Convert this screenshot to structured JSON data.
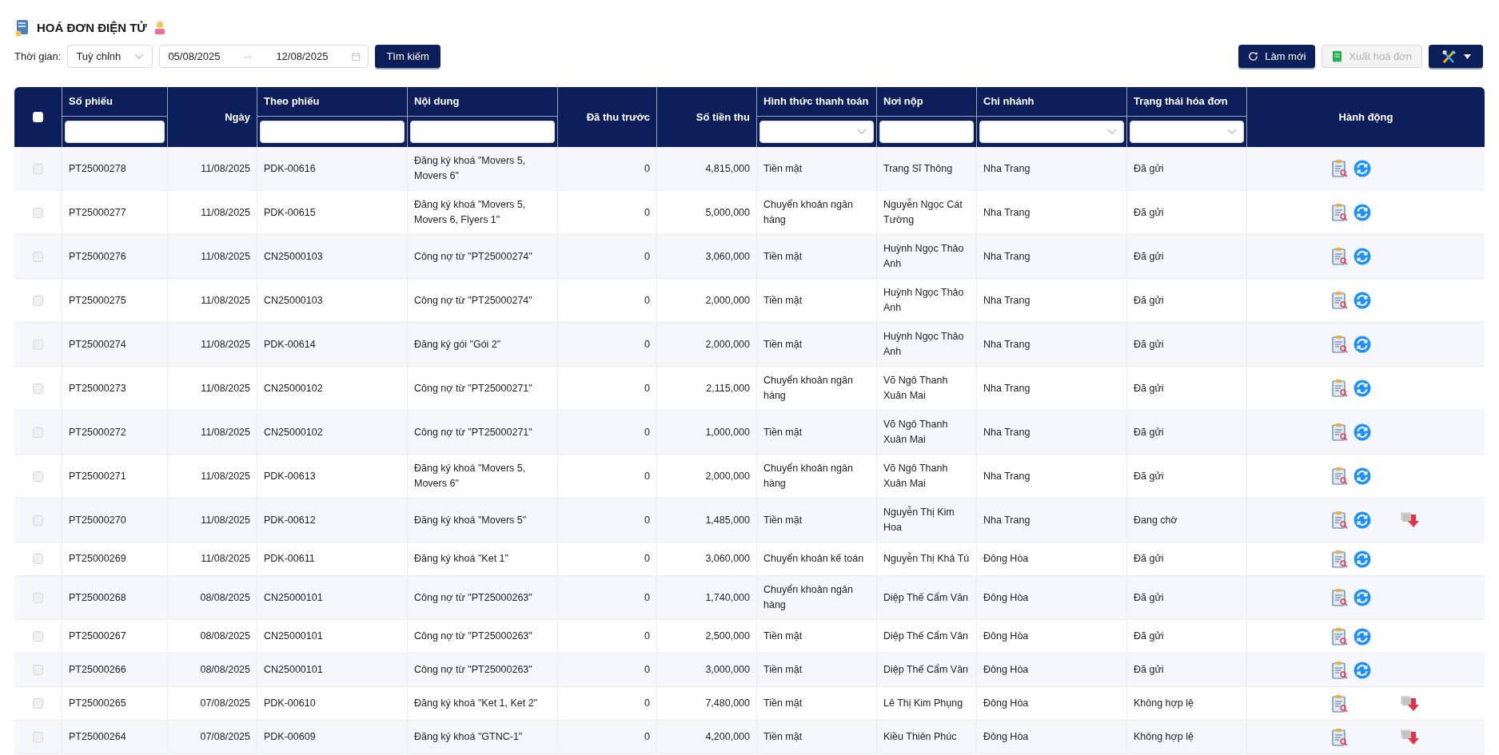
{
  "title": "HOÁ ĐƠN ĐIỆN TỬ",
  "filter_bar": {
    "label": "Thời gian:",
    "period": "Tuỳ chỉnh",
    "date_from": "05/08/2025",
    "date_to": "12/08/2025",
    "search_button": "Tìm kiếm"
  },
  "toolbar": [
    {
      "kind": "refresh",
      "label": "Làm mới",
      "disabled": false
    },
    {
      "kind": "export",
      "label": "Xuất hoá đơn",
      "disabled": true
    },
    {
      "kind": "tools",
      "disabled": false
    }
  ],
  "table": {
    "select_all_checked": false,
    "columns": [
      {
        "label": "Số phiếu",
        "kind": "text"
      },
      {
        "label": "Ngày",
        "kind": "plain"
      },
      {
        "label": "Theo phiếu",
        "kind": "text"
      },
      {
        "label": "Nội dung",
        "kind": "text"
      },
      {
        "label": "Đã thu trước",
        "kind": "plain"
      },
      {
        "label": "Số tiền thu",
        "kind": "plain"
      },
      {
        "label": "Hình thức thanh toán",
        "kind": "select"
      },
      {
        "label": "Nơi nộp",
        "kind": "text"
      },
      {
        "label": "Chi nhánh",
        "kind": "select"
      },
      {
        "label": "Trạng thái hóa đơn",
        "kind": "select"
      },
      {
        "label": "Hành động",
        "kind": "plain"
      }
    ],
    "rows": [
      {
        "checked": false,
        "cells": [
          "PT25000278",
          "11/08/2025",
          "PDK-00616",
          "Đăng ký khoá \"Movers 5, Movers 6\"",
          "0",
          "4,815,000",
          "Tiền mặt",
          "Trang Sĩ Thông",
          "Nha Trang",
          "Đã gửi"
        ],
        "actions": {
          "view": true,
          "sync": true,
          "download": false
        }
      },
      {
        "checked": false,
        "cells": [
          "PT25000277",
          "11/08/2025",
          "PDK-00615",
          "Đăng ký khoá \"Movers 5, Movers 6, Flyers 1\"",
          "0",
          "5,000,000",
          "Chuyển khoản ngân hàng",
          "Nguyễn Ngọc Cát Tường",
          "Nha Trang",
          "Đã gửi"
        ],
        "actions": {
          "view": true,
          "sync": true,
          "download": false
        }
      },
      {
        "checked": false,
        "cells": [
          "PT25000276",
          "11/08/2025",
          "CN25000103",
          "Công nợ từ \"PT25000274\"",
          "0",
          "3,060,000",
          "Tiền mặt",
          "Huỳnh Ngọc Thảo Anh",
          "Nha Trang",
          "Đã gửi"
        ],
        "actions": {
          "view": true,
          "sync": true,
          "download": false
        }
      },
      {
        "checked": false,
        "cells": [
          "PT25000275",
          "11/08/2025",
          "CN25000103",
          "Công nợ từ \"PT25000274\"",
          "0",
          "2,000,000",
          "Tiền mặt",
          "Huỳnh Ngọc Thảo Anh",
          "Nha Trang",
          "Đã gửi"
        ],
        "actions": {
          "view": true,
          "sync": true,
          "download": false
        }
      },
      {
        "checked": false,
        "cells": [
          "PT25000274",
          "11/08/2025",
          "PDK-00614",
          "Đăng ký gói \"Gói 2\"",
          "0",
          "2,000,000",
          "Tiền mặt",
          "Huỳnh Ngọc Thảo Anh",
          "Nha Trang",
          "Đã gửi"
        ],
        "actions": {
          "view": true,
          "sync": true,
          "download": false
        }
      },
      {
        "checked": false,
        "cells": [
          "PT25000273",
          "11/08/2025",
          "CN25000102",
          "Công nợ từ \"PT25000271\"",
          "0",
          "2,115,000",
          "Chuyển khoản ngân hàng",
          "Võ Ngô Thanh Xuân Mai",
          "Nha Trang",
          "Đã gửi"
        ],
        "actions": {
          "view": true,
          "sync": true,
          "download": false
        }
      },
      {
        "checked": false,
        "cells": [
          "PT25000272",
          "11/08/2025",
          "CN25000102",
          "Công nợ từ \"PT25000271\"",
          "0",
          "1,000,000",
          "Tiền mặt",
          "Võ Ngô Thanh Xuân Mai",
          "Nha Trang",
          "Đã gửi"
        ],
        "actions": {
          "view": true,
          "sync": true,
          "download": false
        }
      },
      {
        "checked": false,
        "cells": [
          "PT25000271",
          "11/08/2025",
          "PDK-00613",
          "Đăng ký khoá \"Movers 5, Movers 6\"",
          "0",
          "2,000,000",
          "Chuyển khoản ngân hàng",
          "Võ Ngô Thanh Xuân Mai",
          "Nha Trang",
          "Đã gửi"
        ],
        "actions": {
          "view": true,
          "sync": true,
          "download": false
        }
      },
      {
        "checked": false,
        "cells": [
          "PT25000270",
          "11/08/2025",
          "PDK-00612",
          "Đăng ký khoá \"Movers 5\"",
          "0",
          "1,485,000",
          "Tiền mặt",
          "Nguyễn Thị Kim Hoa",
          "Nha Trang",
          "Đang chờ"
        ],
        "actions": {
          "view": true,
          "sync": true,
          "download": true
        }
      },
      {
        "checked": false,
        "cells": [
          "PT25000269",
          "11/08/2025",
          "PDK-00611",
          "Đăng ký khoá \"Ket 1\"",
          "0",
          "3,060,000",
          "Chuyển khoản kế toán",
          "Nguyễn Thị Khả Tú",
          "Đông Hòa",
          "Đã gửi"
        ],
        "actions": {
          "view": true,
          "sync": true,
          "download": false
        }
      },
      {
        "checked": false,
        "cells": [
          "PT25000268",
          "08/08/2025",
          "CN25000101",
          "Công nợ từ \"PT25000263\"",
          "0",
          "1,740,000",
          "Chuyển khoản ngân hàng",
          "Diệp Thế Cẩm Vân",
          "Đông Hòa",
          "Đã gửi"
        ],
        "actions": {
          "view": true,
          "sync": true,
          "download": false
        }
      },
      {
        "checked": false,
        "cells": [
          "PT25000267",
          "08/08/2025",
          "CN25000101",
          "Công nợ từ \"PT25000263\"",
          "0",
          "2,500,000",
          "Tiền mặt",
          "Diệp Thế Cẩm Vân",
          "Đông Hòa",
          "Đã gửi"
        ],
        "actions": {
          "view": true,
          "sync": true,
          "download": false
        }
      },
      {
        "checked": false,
        "cells": [
          "PT25000266",
          "08/08/2025",
          "CN25000101",
          "Công nợ từ \"PT25000263\"",
          "0",
          "3,000,000",
          "Tiền mặt",
          "Diệp Thế Cẩm Vân",
          "Đông Hòa",
          "Đã gửi"
        ],
        "actions": {
          "view": true,
          "sync": true,
          "download": false
        }
      },
      {
        "checked": false,
        "cells": [
          "PT25000265",
          "07/08/2025",
          "PDK-00610",
          "Đăng ký khoá \"Ket 1, Ket 2\"",
          "0",
          "7,480,000",
          "Tiền mặt",
          "Lê Thị Kim Phụng",
          "Đông Hòa",
          "Không hợp lệ"
        ],
        "actions": {
          "view": true,
          "sync": false,
          "download": true
        }
      },
      {
        "checked": false,
        "cells": [
          "PT25000264",
          "07/08/2025",
          "PDK-00609",
          "Đăng ký khoá \"GTNC-1\"",
          "0",
          "4,200,000",
          "Tiền mặt",
          "Kiều Thiên Phúc",
          "Đông Hòa",
          "Không hợp lệ"
        ],
        "actions": {
          "view": true,
          "sync": false,
          "download": true
        }
      }
    ]
  }
}
